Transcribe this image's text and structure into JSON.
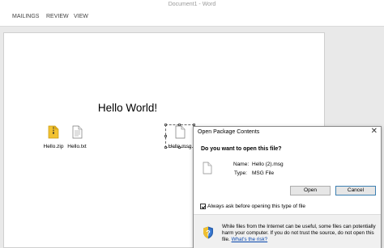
{
  "window": {
    "title": "Document1 - Word"
  },
  "ribbon": {
    "tabs": [
      "MAILINGS",
      "REVIEW",
      "VIEW"
    ]
  },
  "document": {
    "heading": "Hello World!",
    "embedded_files": [
      {
        "label": "Hello.zip",
        "icon": "zip-folder-icon"
      },
      {
        "label": "Hello.txt",
        "icon": "text-file-icon"
      },
      {
        "label": "Hello.msg",
        "icon": "blank-file-icon",
        "selected": true
      }
    ]
  },
  "dialog": {
    "title": "Open Package Contents",
    "close": "✕",
    "question": "Do you want to open this file?",
    "name_label": "Name:",
    "name_value": "Hello (2).msg",
    "type_label": "Type:",
    "type_value": "MSG File",
    "open_button": "Open",
    "cancel_button": "Cancel",
    "checkbox_label": "Always ask before opening this type of file",
    "checkbox_checked": true,
    "warning_text": "While files from the Internet can be useful, some files can potentially harm your computer. If you do not trust the source, do not open this file.",
    "warning_link": "What's the risk?"
  },
  "colors": {
    "accent": "#3c7fb1",
    "link": "#0645ad",
    "zip": "#f2c230"
  }
}
